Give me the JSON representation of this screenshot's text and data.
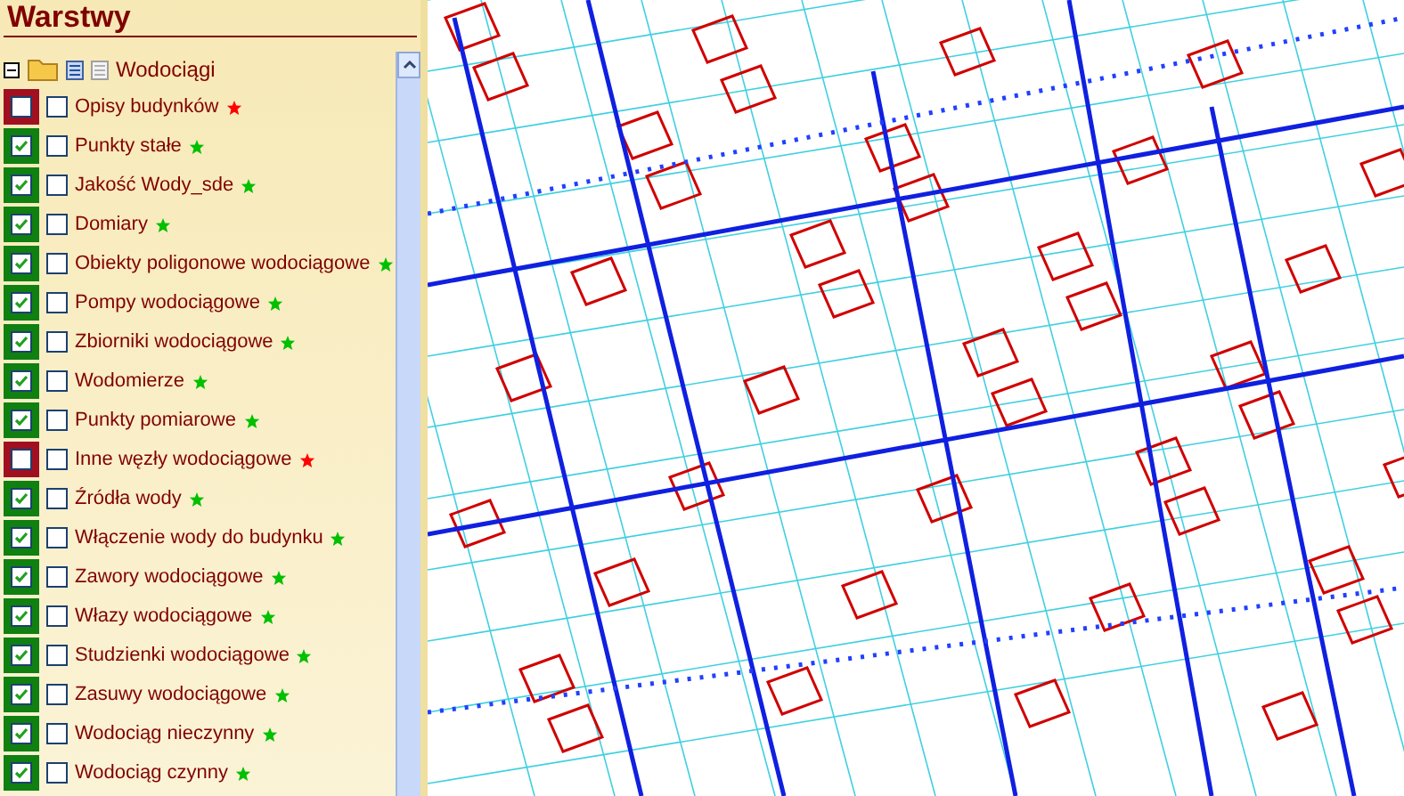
{
  "panel": {
    "title": "Warstwy"
  },
  "group": {
    "label": "Wodociągi",
    "expanded": true
  },
  "layers": [
    {
      "label": "Opisy budynków",
      "checked": false,
      "selectable": false,
      "color": "#ff0000"
    },
    {
      "label": "Punkty stałe",
      "checked": true,
      "selectable": false,
      "color": "#00c000"
    },
    {
      "label": "Jakość Wody_sde",
      "checked": true,
      "selectable": false,
      "color": "#00c000"
    },
    {
      "label": "Domiary",
      "checked": true,
      "selectable": false,
      "color": "#00c000"
    },
    {
      "label": "Obiekty poligonowe wodociągowe",
      "checked": true,
      "selectable": false,
      "color": "#00c000"
    },
    {
      "label": "Pompy wodociągowe",
      "checked": true,
      "selectable": false,
      "color": "#00c000"
    },
    {
      "label": "Zbiorniki wodociągowe",
      "checked": true,
      "selectable": false,
      "color": "#00c000"
    },
    {
      "label": "Wodomierze",
      "checked": true,
      "selectable": false,
      "color": "#00c000"
    },
    {
      "label": "Punkty pomiarowe",
      "checked": true,
      "selectable": false,
      "color": "#00c000"
    },
    {
      "label": "Inne węzły wodociągowe",
      "checked": false,
      "selectable": false,
      "color": "#ff0000"
    },
    {
      "label": "Źródła wody",
      "checked": true,
      "selectable": false,
      "color": "#00c000"
    },
    {
      "label": "Włączenie wody do budynku",
      "checked": true,
      "selectable": false,
      "color": "#00c000"
    },
    {
      "label": "Zawory wodociągowe",
      "checked": true,
      "selectable": false,
      "color": "#00c000"
    },
    {
      "label": "Włazy wodociągowe",
      "checked": true,
      "selectable": false,
      "color": "#00c000"
    },
    {
      "label": "Studzienki wodociągowe",
      "checked": true,
      "selectable": false,
      "color": "#00c000"
    },
    {
      "label": "Zasuwy wodociągowe",
      "checked": true,
      "selectable": false,
      "color": "#00c000"
    },
    {
      "label": "Wodociąg nieczynny",
      "checked": true,
      "selectable": false,
      "color": "#00c000"
    },
    {
      "label": "Wodociąg czynny",
      "checked": true,
      "selectable": false,
      "color": "#00c000"
    }
  ]
}
